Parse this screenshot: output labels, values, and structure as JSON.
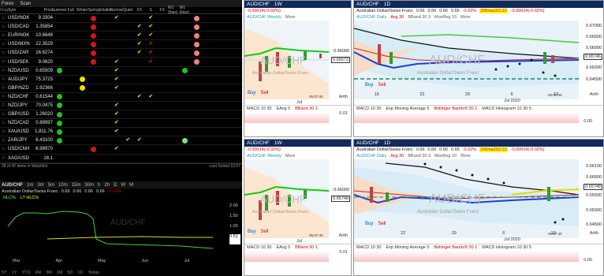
{
  "watchlist": {
    "menu": "Forex",
    "scan": "Scan",
    "cols": [
      "Flag",
      "Sym",
      "Price",
      "Summer",
      "Full",
      "Winter",
      "Spring",
      "Volatile",
      "Normal",
      "Quiet",
      "FX",
      "S",
      "FX",
      "W1 (bias)",
      "W1 (bias)"
    ],
    "rows": [
      {
        "sym": "USD/NOK",
        "price": "9.3304",
        "cells": [
          "",
          "",
          "",
          "red",
          "",
          "ck",
          "",
          "",
          "ck",
          "",
          "",
          "",
          "pink"
        ]
      },
      {
        "sym": "USD/CAD",
        "price": "1.35854",
        "cells": [
          "",
          "",
          "",
          "red",
          "",
          "",
          "",
          "ck",
          "ck",
          "",
          "",
          "",
          "pink"
        ]
      },
      {
        "sym": "EUR/NOK",
        "price": "10.6648",
        "cells": [
          "",
          "",
          "",
          "red",
          "",
          "",
          "",
          "ck",
          "ck",
          "",
          "",
          "",
          "pink"
        ]
      },
      {
        "sym": "USD/MXN",
        "price": "22.3529",
        "cells": [
          "",
          "",
          "",
          "red",
          "",
          "",
          "",
          "ck",
          "rck",
          "",
          "",
          "",
          "pink"
        ]
      },
      {
        "sym": "USD/ZAR",
        "price": "16.6274",
        "cells": [
          "",
          "",
          "",
          "red",
          "",
          "",
          "",
          "ck",
          "rck",
          "",
          "",
          "",
          "pink"
        ]
      },
      {
        "sym": "USD/SEK",
        "price": "9.0620",
        "cells": [
          "",
          "",
          "",
          "red",
          "",
          "ck",
          "",
          "",
          "rck",
          "",
          "",
          "",
          "pink"
        ]
      },
      {
        "sym": "NZD/USD",
        "price": "0.65509",
        "cells": [
          "green",
          "",
          "",
          "",
          "",
          "ck",
          "",
          "",
          "",
          "",
          "",
          "green",
          ""
        ]
      },
      {
        "sym": "AUD/JPY",
        "price": "75.3725",
        "cells": [
          "",
          "",
          "yellow",
          "",
          "",
          "ck",
          "",
          "",
          "",
          "",
          "",
          "",
          ""
        ]
      },
      {
        "sym": "GBP/NZD",
        "price": "1.92366",
        "cells": [
          "",
          "",
          "yellow",
          "",
          "",
          "ck",
          "",
          "",
          "",
          "",
          "",
          "",
          ""
        ]
      },
      {
        "sym": "NZD/CHF",
        "price": "0.61544",
        "cells": [
          "green",
          "",
          "",
          "",
          "",
          "",
          "",
          "ck",
          "ck",
          "",
          "",
          "",
          ""
        ]
      },
      {
        "sym": "NZD/JPY",
        "price": "70.0475",
        "cells": [
          "green",
          "",
          "",
          "",
          "",
          "ck",
          "",
          "",
          "",
          "",
          "",
          "",
          ""
        ]
      },
      {
        "sym": "GBP/USD",
        "price": "1.26020",
        "cells": [
          "green",
          "",
          "",
          "",
          "",
          "ck",
          "",
          "",
          "",
          "",
          "",
          "",
          ""
        ]
      },
      {
        "sym": "NZD/CAD",
        "price": "0.88997",
        "cells": [
          "green",
          "",
          "",
          "",
          "",
          "ck",
          "",
          "",
          "",
          "",
          "",
          "",
          ""
        ]
      },
      {
        "sym": "XAU/USD",
        "price": "1,811.76",
        "cells": [
          "green",
          "",
          "",
          "",
          "",
          "ck",
          "",
          "",
          "",
          "",
          "",
          "",
          ""
        ]
      },
      {
        "sym": "ZAR/JPY",
        "price": "6.43100",
        "cells": [
          "green",
          "",
          "",
          "",
          "",
          "",
          "ck",
          "ck",
          "",
          "",
          "",
          "lgreen",
          ""
        ]
      },
      {
        "sym": "USD/CNH",
        "price": "6.98970",
        "cells": [
          "",
          "",
          "",
          "red",
          "",
          "ck",
          "",
          "",
          "",
          "",
          "",
          "",
          ""
        ]
      },
      {
        "sym": "XAG/USD",
        "price": "18.1",
        "cells": [
          "",
          "",
          "",
          "",
          "",
          "",
          "",
          "",
          "",
          "",
          "",
          "",
          ""
        ]
      }
    ],
    "footer_left": "28 of 42 items in Watchlist",
    "footer_right": "Last Sorted 12:07"
  },
  "left_chart": {
    "symbol": "AUD/CHF",
    "tfs": [
      "1m",
      "3m",
      "5m",
      "10m",
      "15m",
      "30m",
      "h",
      "2h",
      "D",
      "W",
      "M"
    ],
    "desc": "Australian Dollar/Swiss Franc",
    "q": [
      "0.66",
      "0.66",
      "0.66",
      "0.66",
      "0.66"
    ],
    "chg": "-0.02%",
    "s1": "HLC%",
    "s2": "LT HLC%",
    "xlabels": [
      "Mar",
      "Apr",
      "May",
      "Jun",
      "Jul"
    ],
    "ylabels": [
      "2.00",
      "1.50",
      "1.00",
      "0.51",
      "0.00"
    ],
    "value": "0.51",
    "time": "05:07:40",
    "ranges": [
      "5Y",
      "1Y",
      "YTD",
      "6M",
      "3M",
      "1M",
      "5D",
      "1D",
      "Today"
    ]
  },
  "panels": {
    "top_left": {
      "symbol": "AUD/CHF",
      "tf": "1W",
      "pinfo": "0.65573",
      "chg": "-0.00014(-0.02%)",
      "legend": "AUD/CHF Weekly",
      "wm": "AUD/CHF",
      "wm2": "Australian Dollar/Swiss Franc",
      "ylabels": [
        "0.66000",
        "0.65573"
      ],
      "buy": "Buy",
      "sell": "Sell",
      "xlabel": "Jul",
      "time": "05:07:40",
      "ind": "MACD 10 30",
      "ind2": "EAvg 5",
      "ind3": "BBand 30 1",
      "sub": "0.01",
      "more": "More",
      "arith": "Arith"
    },
    "top_right": {
      "symbol": "AUD/CHF",
      "tf": "1D",
      "desc": "Australian Dollar/Swiss Franc",
      "q": [
        "0.66",
        "0.66",
        "0.66",
        "0.66"
      ],
      "chg": "-0.02%",
      "tag": "200ma102.22",
      "chg2": "-0.00014(-0.02%)",
      "legend": [
        "AUD/CHF Daily",
        "Avg 30",
        "BBand 30 3",
        "MovReg 10",
        "More"
      ],
      "wm": "AUD/CHF",
      "wm2": "Australian Dollar/Swiss Franc",
      "ylabels": [
        "0.67000",
        "0.66500",
        "0.66000",
        "0.65746",
        "0.65000",
        "0.64500"
      ],
      "xlabels": [
        "15",
        "22",
        "29",
        "6",
        "13"
      ],
      "month": "Jul 2020",
      "buy": "Buy",
      "sell": "Sell",
      "time": "05:07:40",
      "ind": [
        "MACD 10 30",
        "Exp Moving Average 5",
        "Bollinger Bands® 30 1",
        "MACD Histogram 10 30 5"
      ],
      "sub": "0.00",
      "arith": "Arith"
    },
    "bot_left": {
      "symbol": "AUD/CHF",
      "tf": "1W",
      "pinfo": "0.65748",
      "chg": "-0.00014(-0.02%)",
      "legend": "AUD/CHF Weekly",
      "wm": "AUD/CHF",
      "wm2": "Australian Dollar/Swiss Franc",
      "ylabels": [
        "0.66000",
        "0.65748"
      ],
      "buy": "Buy",
      "sell": "Sell",
      "xlabel": "Jul",
      "time": "05:07:40",
      "ind": "MACD 10 30",
      "ind2": "EAvg 5",
      "ind3": "BBand 30 1",
      "sub": "0.01",
      "more": "More",
      "arith": "Arith"
    },
    "bot_right": {
      "symbol": "AUD/CHF",
      "tf": "1D",
      "desc": "Australian Dollar/Swiss Franc",
      "q": [
        "0.66",
        "0.66",
        "0.66",
        "0.66"
      ],
      "chg": "-0.02%",
      "tag": "200ma102.22",
      "chg2": "-0.00014(-0.02%)",
      "legend": [
        "AUD/CHF Daily",
        "Avg 30",
        "BBand 30 3",
        "MovReg 10",
        "More"
      ],
      "wm": "AUD/CHF",
      "wm2": "Australian Dollar/Swiss Franc",
      "ylabels": [
        "0.66100",
        "0.66000",
        "0.65748",
        "0.65500",
        "0.65000",
        "0.64500"
      ],
      "xlabels": [
        "22",
        "29",
        "6",
        "13"
      ],
      "month": "Jul 2020",
      "buy": "Buy",
      "sell": "Sell",
      "time": "05:07:40",
      "ind": [
        "MACD 10 30",
        "Exp Moving Average 5",
        "Bollinger Bands® 30 1",
        "MACD Histogram 10 30 5"
      ],
      "sub": "0.00",
      "arith": "Arith"
    }
  }
}
